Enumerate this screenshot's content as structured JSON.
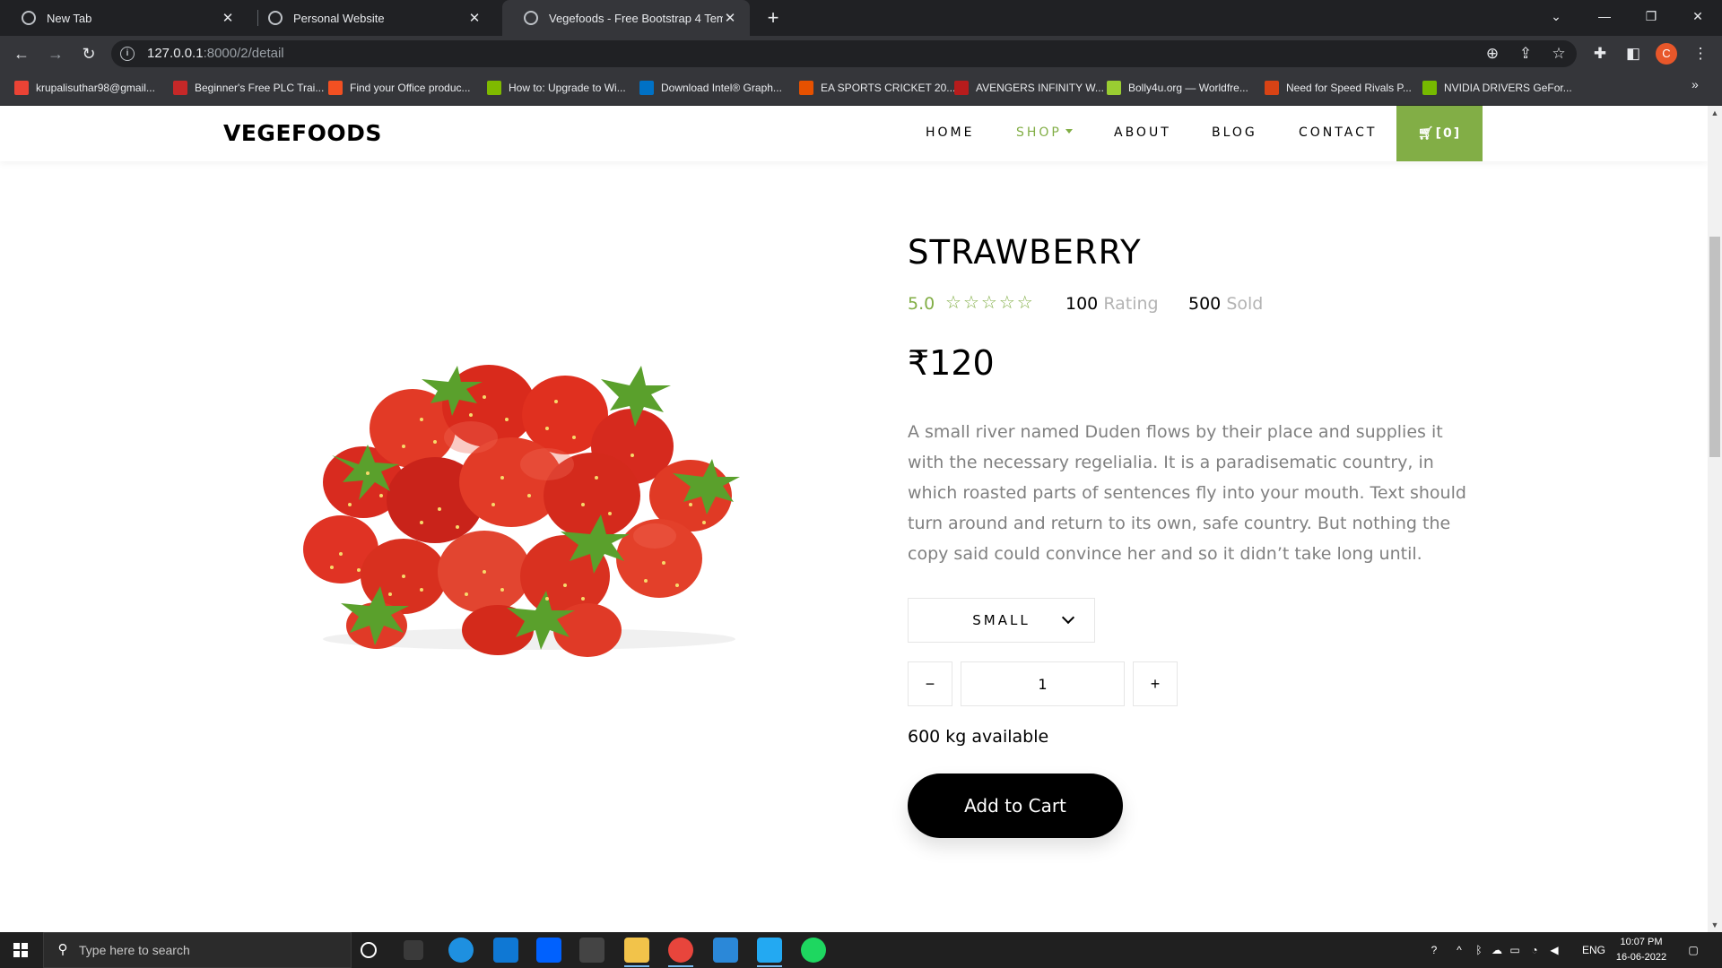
{
  "browser": {
    "tabs": [
      {
        "label": "New Tab",
        "active": false
      },
      {
        "label": "Personal Website",
        "active": false
      },
      {
        "label": "Vegefoods - Free Bootstrap 4 Template",
        "active": true
      }
    ],
    "url_host": "127.0.0.1",
    "url_path": ":8000/2/detail",
    "profile_initial": "C",
    "bookmarks": [
      {
        "label": "krupalisuthar98@gmail...",
        "icon_color": "#ea4335"
      },
      {
        "label": "Beginner's Free PLC Trai...",
        "icon_color": "#c62828"
      },
      {
        "label": "Find your Office produc...",
        "icon_color": "#f25022"
      },
      {
        "label": "How to: Upgrade to Wi...",
        "icon_color": "#7fba00"
      },
      {
        "label": "Download Intel® Graph...",
        "icon_color": "#0071c5"
      },
      {
        "label": "EA SPORTS CRICKET 20...",
        "icon_color": "#e65100"
      },
      {
        "label": "AVENGERS INFINITY W...",
        "icon_color": "#b71c1c"
      },
      {
        "label": "Bolly4u.org — Worldfre...",
        "icon_color": "#9acd32"
      },
      {
        "label": "Need for Speed Rivals P...",
        "icon_color": "#d84315"
      },
      {
        "label": "NVIDIA DRIVERS GeFor...",
        "icon_color": "#76b900"
      }
    ]
  },
  "site": {
    "brand": "VEGEFOODS",
    "nav": [
      "HOME",
      "SHOP",
      "ABOUT",
      "BLOG",
      "CONTACT"
    ],
    "cart_label": "[0]",
    "accent": "#82ae46"
  },
  "product": {
    "title": "STRAWBERRY",
    "rating": "5.0",
    "stars_count": 5,
    "rating_count": "100",
    "rating_label": "Rating",
    "sold_count": "500",
    "sold_label": "Sold",
    "price": "₹120",
    "description": "A small river named Duden flows by their place and supplies it with the necessary regelialia. It is a paradisematic country, in which roasted parts of sentences fly into your mouth. Text should turn around and return to its own, safe country. But nothing the copy said could convince her and so it didn’t take long until.",
    "size_selected": "SMALL",
    "qty_minus": "−",
    "quantity": "1",
    "qty_plus": "+",
    "availability": "600 kg available",
    "add_to_cart": "Add to Cart"
  },
  "taskbar": {
    "search_placeholder": "Type here to search",
    "language": "ENG",
    "time": "10:07 PM",
    "date": "16-06-2022"
  }
}
